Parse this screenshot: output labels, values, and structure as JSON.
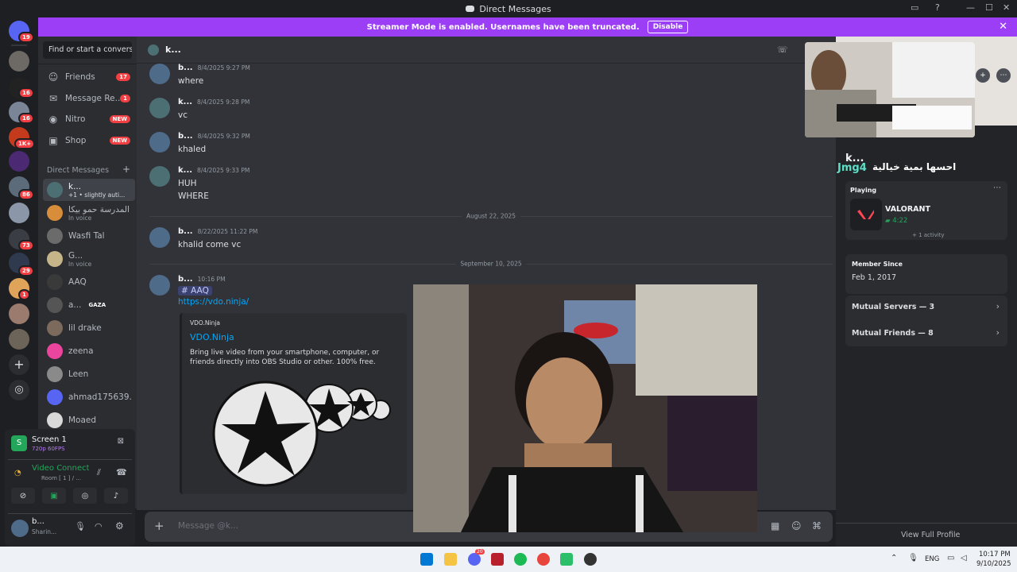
{
  "window": {
    "title": "Direct Messages"
  },
  "banner": {
    "text": "Streamer Mode is enabled. Usernames have been truncated.",
    "button": "Disable"
  },
  "guild_badges": [
    "19",
    "16",
    "16",
    "1K+",
    "86",
    "73",
    "29",
    "1"
  ],
  "sidebar": {
    "search_placeholder": "Find or start a convers...",
    "nav": [
      {
        "label": "Friends",
        "badge": "17",
        "icon": "friends-icon"
      },
      {
        "label": "Message Re...",
        "badge": "1",
        "icon": "inbox-icon"
      },
      {
        "label": "Nitro",
        "badge": "NEW",
        "icon": "nitro-icon"
      },
      {
        "label": "Shop",
        "badge": "NEW",
        "icon": "shop-icon"
      }
    ],
    "dm_header": "Direct Messages",
    "dms": [
      {
        "name": "k...",
        "sub": "+1 • slightly auti..."
      },
      {
        "name": "المدرسة حمو بيكا",
        "sub": "In voice"
      },
      {
        "name": "Wasfi Tal",
        "sub": ""
      },
      {
        "name": "G...",
        "sub": "In voice"
      },
      {
        "name": "AAQ",
        "sub": ""
      },
      {
        "name": "a...",
        "tag": "GAZA",
        "sub": ""
      },
      {
        "name": "lil drake",
        "sub": ""
      },
      {
        "name": "zeena",
        "sub": ""
      },
      {
        "name": "Leen",
        "sub": ""
      },
      {
        "name": "ahmad175639.",
        "sub": ""
      },
      {
        "name": "Moaed",
        "sub": ""
      }
    ]
  },
  "screen_panel": {
    "title": "Screen 1",
    "quality": "720p 60FPS"
  },
  "voice_panel": {
    "status": "Video Connected",
    "room": "Room [ 1 ] / ..."
  },
  "user_panel": {
    "name": "b...",
    "status": "Sharin..."
  },
  "chat": {
    "header_name": "k...",
    "messages": [
      {
        "author": "b...",
        "time": "8/4/2025 9:27 PM",
        "lines": [
          "where"
        ]
      },
      {
        "author": "k...",
        "time": "8/4/2025 9:28 PM",
        "lines": [
          "vc"
        ]
      },
      {
        "author": "b...",
        "time": "8/4/2025 9:32 PM",
        "lines": [
          "khaled"
        ]
      },
      {
        "author": "k...",
        "time": "8/4/2025 9:33 PM",
        "lines": [
          "HUH",
          "WHERE"
        ]
      },
      {
        "author": "b...",
        "time": "8/22/2025 11:22 PM",
        "lines": [
          "khalid come vc"
        ]
      },
      {
        "author": "b...",
        "time": "10:16 PM",
        "lines": []
      }
    ],
    "dividers": [
      "August 22, 2025",
      "September 10, 2025"
    ],
    "channel_mention": "AAQ",
    "link": "https://vdo.ninja/",
    "embed": {
      "provider": "VDO.Ninja",
      "title": "VDO.Ninja",
      "description": "Bring live video from your smartphone, computer, or friends directly into OBS Studio or other. 100% free."
    },
    "composer_placeholder": "Message @k..."
  },
  "profile": {
    "name": "k...",
    "tag_overlay": "Jmg4",
    "arabic_status": "احسها بمية خيالية",
    "playing_label": "Playing",
    "game": "VALORANT",
    "game_time": "4:22",
    "activity_more": "+ 1 activity",
    "member_since_label": "Member Since",
    "member_since": "Feb 1, 2017",
    "mutual_servers": "Mutual Servers — 3",
    "mutual_friends": "Mutual Friends — 8",
    "view_full": "View Full Profile"
  },
  "taskbar": {
    "lang": "ENG",
    "time": "10:17 PM",
    "date": "9/10/2025",
    "discord_badge": "20"
  },
  "colors": {
    "accent": "#5865f2",
    "banner": "#9b3ef5",
    "green": "#23a55a",
    "red": "#f23f43"
  }
}
